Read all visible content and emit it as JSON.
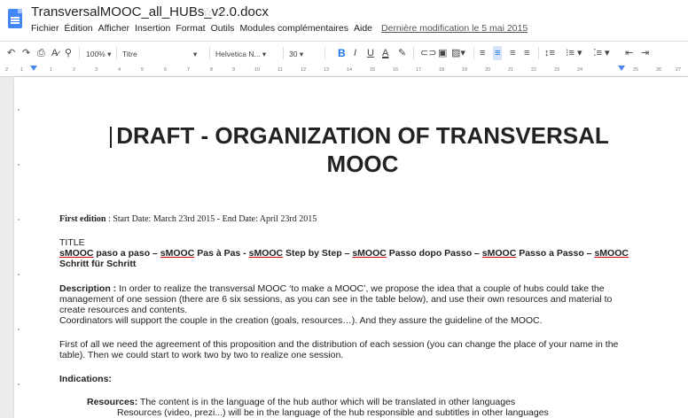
{
  "header": {
    "title": "TransversalMOOC_all_HUBs_v2.0.docx",
    "menu": [
      "Fichier",
      "Édition",
      "Afficher",
      "Insertion",
      "Format",
      "Outils",
      "Modules complémentaires",
      "Aide"
    ],
    "last_modified": "Dernière modification le 5 mai 2015"
  },
  "toolbar": {
    "zoom": "100%",
    "style": "Titre",
    "font": "Helvetica N...",
    "size": "30"
  },
  "ruler": [
    "2",
    "1",
    "1",
    "2",
    "3",
    "4",
    "5",
    "6",
    "7",
    "8",
    "9",
    "10",
    "11",
    "12",
    "13",
    "14",
    "15",
    "16",
    "17",
    "18",
    "19",
    "20",
    "21",
    "22",
    "23",
    "24",
    "25",
    "26",
    "27"
  ],
  "document": {
    "title_line1": "DRAFT - ORGANIZATION OF TRANSVERSAL",
    "title_line2": "MOOC",
    "edition_label": "First edition",
    "edition_text": " : Start Date: March 23rd  2015 - End Date:  April 23rd 2015",
    "title_heading": "TITLE",
    "title_line_a": [
      {
        "t": "sMOOC",
        "u": true
      },
      {
        "t": " paso a paso – ",
        "u": false
      },
      {
        "t": "sMOOC",
        "u": true
      },
      {
        "t": " Pas à Pas - ",
        "u": false
      },
      {
        "t": "sMOOC",
        "u": true
      },
      {
        "t": " Step by Step – ",
        "u": false
      },
      {
        "t": "sMOOC",
        "u": true
      },
      {
        "t": " Passo dopo Passo – ",
        "u": false
      },
      {
        "t": "sMOOC",
        "u": true
      },
      {
        "t": " Passo a Passo – ",
        "u": false
      },
      {
        "t": "sMOOC",
        "u": true
      }
    ],
    "title_line_b": "Schritt für Schritt",
    "desc_label": "Description :",
    "desc_line1": " In order to realize the transversal MOOC ‘to make a MOOC’, we propose the idea that a couple of hubs could take the",
    "desc_line2": "management of one session (there are 6 six sessions, as you can see in the table below), and use their own resources and material to",
    "desc_line3": "create resources and contents.",
    "desc_line4": "Coordinators will support the couple in the creation (goals, resources…). And they assure the guideline of the MOOC.",
    "agree_line1": "First of all we need the agreement of this proposition and the distribution of each session (you can change the place of your name in the",
    "agree_line2": "table). Then we could start to work two by two to realize one session.",
    "indications": "Indications:",
    "resources_label": "Resources:",
    "resources_text": " The content is in the language of the hub author which will be translated in other languages",
    "resources_sub": "Resources (video, prezi...) will be in the language of the hub responsible and subtitles in other languages"
  },
  "colors": {
    "accent": "#1a73e8",
    "doc_icon": "#4285f4",
    "spell_underline": "#cc0000"
  }
}
